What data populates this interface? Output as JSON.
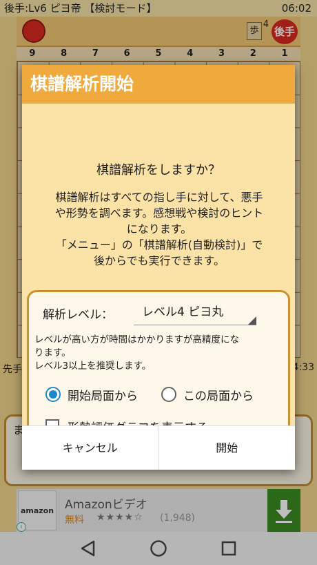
{
  "status_bar": {
    "left_text": "後手:Lv6 ピヨ帝 【検討モード】",
    "time": "06:02"
  },
  "board": {
    "columns": [
      "9",
      "8",
      "7",
      "6",
      "5",
      "4",
      "3",
      "2",
      "1"
    ],
    "captured_piece": "歩",
    "captured_count": "4",
    "turn_badge": "後手",
    "bottom_left_label": "先手",
    "bottom_right_label": "4:33",
    "comment_text": "ま"
  },
  "dialog": {
    "title": "棋譜解析開始",
    "question": "棋譜解析をしますか？",
    "description_lines": [
      "棋譜解析はすべての指し手に対して、悪手",
      "や形勢を調べます。感想戦や検討のヒント",
      "になります。",
      "「メニュー」の「棋譜解析(自動検討)」で",
      "後からでも実行できます。"
    ],
    "level_label": "解析レベル：",
    "level_value": "レベル4 ピヨ丸",
    "level_note_lines": [
      "レベルが高い方が時間はかかりますが高精度にな",
      "ります。",
      "レベル3以上を推奨します。"
    ],
    "radio_options": [
      {
        "label": "開始局面から",
        "checked": true
      },
      {
        "label": "この局面から",
        "checked": false
      }
    ],
    "checkbox": {
      "label": "形勢評価グラフを表示する",
      "checked": false
    },
    "cancel_label": "キャンセル",
    "start_label": "開始"
  },
  "ad": {
    "logo_text": "amazon",
    "title": "Amazonビデオ",
    "price": "無料",
    "stars": "★★★★☆",
    "rating_count": "(1,948)"
  },
  "colors": {
    "accent": "#f0a93d",
    "radio": "#1e88c8",
    "frame": "#c99233"
  }
}
